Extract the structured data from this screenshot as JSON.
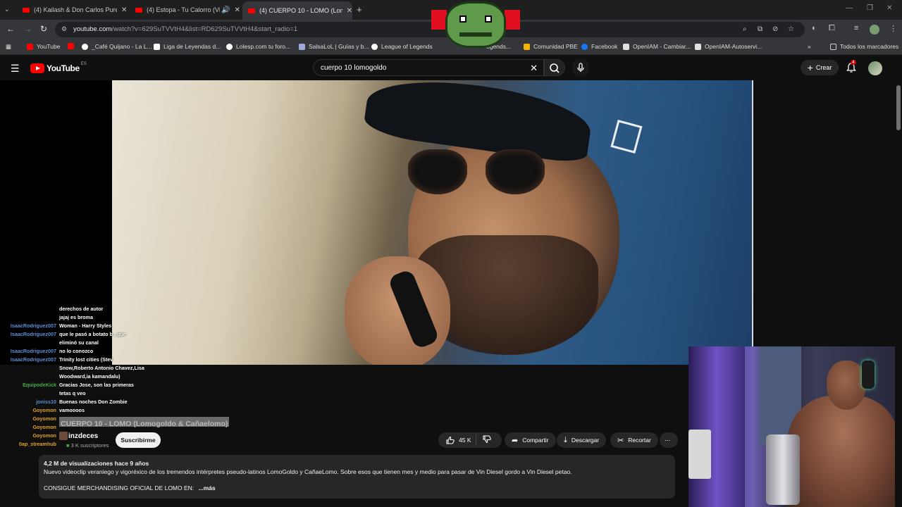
{
  "browser": {
    "tabs": [
      {
        "title": "(4) Kailash & Don Carlos Pure R"
      },
      {
        "title": "(4) Estopa - Tu Calorro (Vid"
      },
      {
        "title": "(4) CUERPO 10 - LOMO (Lomog"
      }
    ],
    "address": {
      "url_main": "youtube.com",
      "url_path": "/watch?v=629SuTVVtH4&list=RD629SuTVVtH4&start_radio=1"
    },
    "bookmarks": [
      {
        "label": "YouTube",
        "color": "#ff0000"
      },
      {
        "label": "",
        "color": "#ff0000"
      },
      {
        "label": "_Café Quijano - La L...",
        "color": "#ffffff"
      },
      {
        "label": "Liga de Leyendas d...",
        "color": "#ffffff"
      },
      {
        "label": "Lolesp.com tu foro...",
        "color": "#ffffff"
      },
      {
        "label": "SalsaLoL | Guías y b...",
        "color": "#9fa8da"
      },
      {
        "label": "League of Legends",
        "color": "#ffffff"
      },
      {
        "label": "egends...",
        "color": "#1e88e5"
      },
      {
        "label": "Comunidad PBE",
        "color": "#f4b400"
      },
      {
        "label": "Facebook",
        "color": "#1877f2"
      },
      {
        "label": "OpenIAM - Cambiar...",
        "color": "#e0e0e0"
      },
      {
        "label": "OpenIAM-Autoservi...",
        "color": "#e0e0e0"
      }
    ],
    "all_bookmarks": "Todos los marcadores"
  },
  "youtube": {
    "logo": "YouTube",
    "region": "ES",
    "search_value": "cuerpo 10 lomogoldo",
    "create_label": "Crear",
    "notif_count": "4"
  },
  "video": {
    "title": "CUERPO 10 - LOMO (Lomogoldo & Cañaelomo)",
    "channel_name": "inzdeces",
    "subscribers": "3 K suscriptores",
    "subscribe_label": "Suscribirme",
    "likes": "45 K",
    "share_label": "Compartir",
    "download_label": "Descargar",
    "clip_label": "Recortar",
    "views_date": "4,2 M de visualizaciones  hace 9 años",
    "description_line1": "Nuevo videoclip  veraniego y vigoréxico de los tremendos intérpretes pseudo-latinos LomoGoldo y CañaeLomo. Sobre esos que tienen mes y medio para pasar de Vin Diesel gordo a Vin Diesel petao.",
    "description_line2": "CONSIGUE MERCHANDISING OFICIAL DE LOMO EN: ",
    "more_label": "...más"
  },
  "chat": [
    {
      "user": "",
      "msg": "derechos de autor",
      "color": "#ffffff"
    },
    {
      "user": "",
      "msg": "jajaj es broma",
      "color": "#b10000"
    },
    {
      "user": "IsaacRodriguez007",
      "msg": "Woman - Harry Styles",
      "color": "#5b8fd6"
    },
    {
      "user": "IsaacRodriguez007",
      "msg": "que le pasó a botato b    , que",
      "color": "#5b8fd6"
    },
    {
      "user": "",
      "msg": "eliminó su canal",
      "color": "#5b8fd6"
    },
    {
      "user": "IsaacRodriguez007",
      "msg": "no lo conozco",
      "color": "#5b8fd6"
    },
    {
      "user": "IsaacRodriguez007",
      "msg": "Trinity lost cities (Stev",
      "color": "#5b8fd6"
    },
    {
      "user": "",
      "msg": "Snow,Roberto Antonio Chavez,Lisa",
      "color": "#5b8fd6"
    },
    {
      "user": "",
      "msg": "Woodward,ia kamandalu)",
      "color": "#5b8fd6"
    },
    {
      "user": "EquipodeKick",
      "msg": "Gracias Jose, son las primeras",
      "color": "#3fae3f"
    },
    {
      "user": "",
      "msg": "tetas q veo",
      "color": "#3fae3f"
    },
    {
      "user": "joniss10",
      "msg": "Buenas noches Don Zombie",
      "color": "#5b8fd6"
    },
    {
      "user": "Goyomon",
      "msg": "vamoooos",
      "color": "#e0a020"
    },
    {
      "user": "Goyomon",
      "msg": "",
      "color": "#e0a020"
    },
    {
      "user": "Goyomon",
      "msg": "",
      "color": "#e0a020"
    },
    {
      "user": "Goyomon",
      "msg": "",
      "color": "#e0a020"
    },
    {
      "user": "0ap_streamhub",
      "msg": "",
      "color": "#e0a020"
    }
  ]
}
